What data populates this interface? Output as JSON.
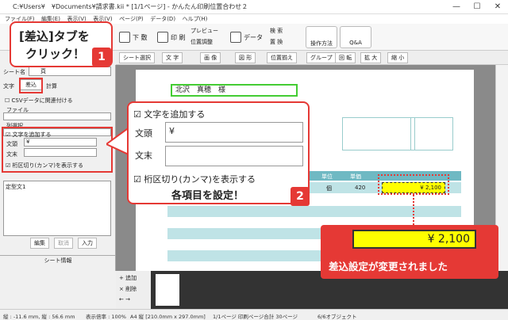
{
  "window": {
    "title": "C:¥Users¥　¥Documents¥請求書.kii * [1/1ページ] - かんたん印刷位置合わせ２"
  },
  "menu": [
    "ファイル(F)",
    "編集(E)",
    "表示(V)",
    "表示(V)",
    "ページ(P)",
    "データ(D)",
    "ヘルプ(H)"
  ],
  "toolbar": {
    "print_preview": "下 敷",
    "print": "印 刷",
    "preview": "プレビュー",
    "position": "位置調整",
    "data": "データ",
    "search": "検 索",
    "replace": "置 換",
    "howto": "操作方法",
    "qa": "Q&A"
  },
  "subtools": [
    "シート選択",
    "文 字",
    "画 像",
    "図 形",
    "位置揃え",
    "グループ",
    "回 転",
    "拡 大",
    "縮 小"
  ],
  "left": {
    "sheet_name_label": "シート名",
    "sheet_name_value": "頁",
    "tabs": [
      "文字",
      "差込",
      "計算"
    ],
    "csv_label": "CSVデータに関連付ける",
    "file_label": "ファイル",
    "column_label": "列選択",
    "add_text_label": "文字を追加する",
    "head_label": "文頭",
    "head_value": "¥",
    "tail_label": "文末",
    "separator_label": "桁区切り(カンマ)を表示する",
    "fixed_label": "定型文",
    "fixed_value": "定型文1",
    "buttons": [
      "編集",
      "取消",
      "入力"
    ],
    "sheet_info": "シート情報",
    "side_buttons": [
      "+ 追加",
      "× 削除",
      "← →"
    ]
  },
  "document": {
    "name": "北沢　真穂　様",
    "col_unit": "単位",
    "col_price": "単価",
    "cell_unit": "個",
    "cell_price": "420",
    "cell_amount": "¥ 2,100"
  },
  "callout1": {
    "text1": "[差込]タブを",
    "text2": "クリック！",
    "badge": "1"
  },
  "callout2": {
    "add_text": "文字を追加する",
    "head": "文頭",
    "head_value": "¥",
    "tail": "文末",
    "separator": "桁区切り(カンマ)を表示する",
    "caption": "各項目を設定！",
    "badge": "2"
  },
  "callout3": {
    "value": "¥ 2,100",
    "caption": "差込設定が変更されました"
  },
  "status": [
    "縦 : -11.6 mm, 縦 : 56.6 mm",
    "表示倍率 : 100%",
    "A4 縦 [210.0mm x 297.0mm]",
    "1/1ページ 印刷ページ合計 30ページ",
    "6/6オブジェクト"
  ],
  "colors": {
    "accent": "#e53935",
    "highlight": "#ffff00",
    "teal": "#bfe3e6",
    "name_border": "#44cc33"
  }
}
